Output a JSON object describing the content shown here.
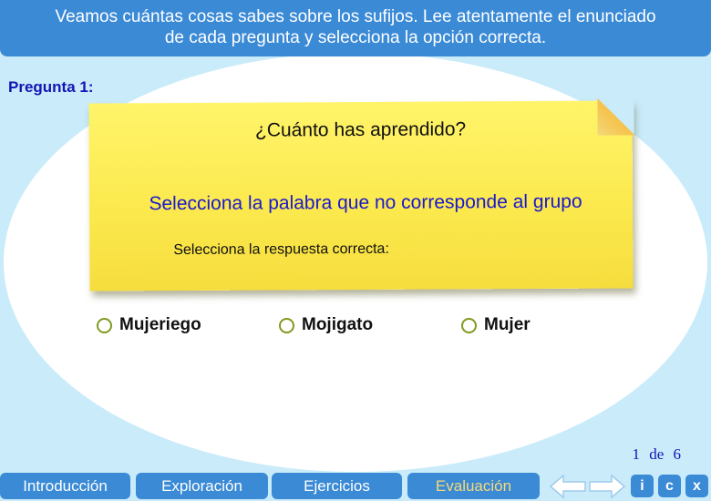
{
  "header": {
    "line1": "Veamos cuántas cosas sabes sobre los sufijos. Lee atentamente el enunciado",
    "line2": "de cada pregunta y selecciona la opción correcta."
  },
  "question": {
    "label": "Pregunta 1:",
    "title": "¿Cuánto has aprendido?",
    "prompt": "Selecciona la palabra que no corresponde al grupo",
    "instruction": "Selecciona la respuesta correcta:"
  },
  "options": [
    {
      "label": "Mujeriego"
    },
    {
      "label": "Mojigato"
    },
    {
      "label": "Mujer"
    }
  ],
  "pager": {
    "current": "1",
    "of": "de",
    "total": "6"
  },
  "nav": {
    "tabs": [
      {
        "label": "Introducción"
      },
      {
        "label": "Exploración"
      },
      {
        "label": "Ejercicios"
      },
      {
        "label": "Evaluación",
        "active": true
      }
    ],
    "arrow_left_icon": "arrow-left-icon",
    "arrow_right_icon": "arrow-right-icon",
    "info_label": "i",
    "c_label": "c",
    "close_label": "x"
  },
  "colors": {
    "accent": "#3a8ad6",
    "background": "#c9ebfa",
    "note": "#fbe84c",
    "prompt_text": "#1a1acc",
    "active_tab_text": "#f6d97a",
    "radio": "#7f9a20"
  }
}
